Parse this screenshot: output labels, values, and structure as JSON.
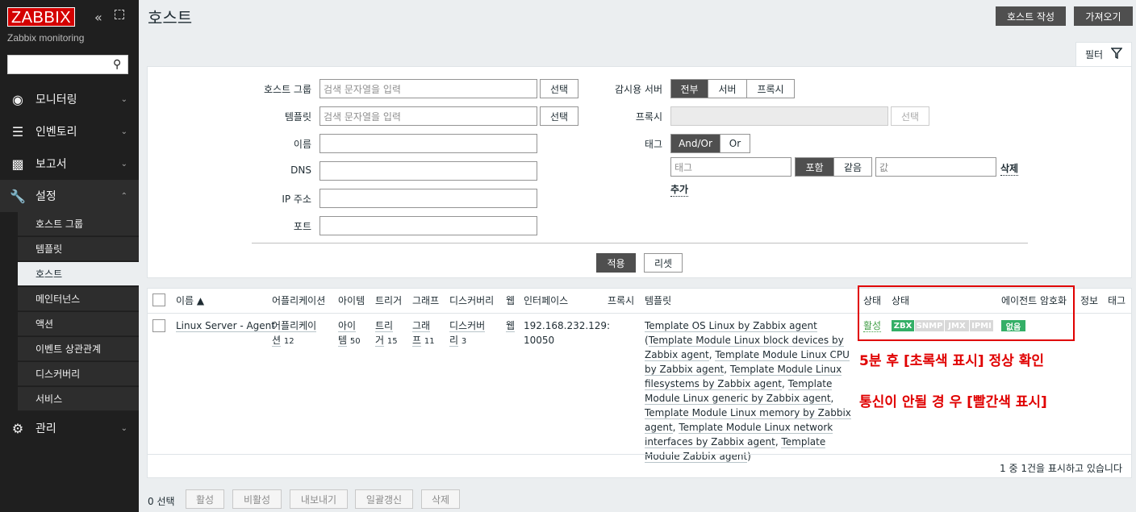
{
  "sidebar": {
    "logo": "ZABBIX",
    "collapse_icon": "«",
    "subtitle": "Zabbix monitoring",
    "search_placeholder": "",
    "menu": [
      {
        "label": "모니터링",
        "icon": "eye-icon"
      },
      {
        "label": "인벤토리",
        "icon": "list-icon"
      },
      {
        "label": "보고서",
        "icon": "bar-chart-icon"
      },
      {
        "label": "설정",
        "icon": "wrench-icon"
      },
      {
        "label": "관리",
        "icon": "gear-icon"
      }
    ],
    "config_submenu": [
      "호스트 그룹",
      "템플릿",
      "호스트",
      "메인터넌스",
      "액션",
      "이벤트 상관관계",
      "디스커버리",
      "서비스"
    ],
    "selected_submenu": "호스트"
  },
  "header": {
    "title": "호스트",
    "create_label": "호스트 작성",
    "import_label": "가져오기"
  },
  "filter": {
    "tab_label": "필터",
    "host_group_label": "호스트 그룹",
    "host_group_placeholder": "검색 문자열을 입력",
    "template_label": "템플릿",
    "template_placeholder": "검색 문자열을 입력",
    "name_label": "이름",
    "dns_label": "DNS",
    "ip_label": "IP 주소",
    "port_label": "포트",
    "select_label": "선택",
    "monitored_by_label": "감시용 서버",
    "monitored_by_options": [
      "전부",
      "서버",
      "프록시"
    ],
    "monitored_by_selected": "전부",
    "proxy_label": "프록시",
    "tags_label": "태그",
    "tag_logic_options": [
      "And/Or",
      "Or"
    ],
    "tag_logic_selected": "And/Or",
    "tag_placeholder": "태그",
    "tag_operator_options": [
      "포함",
      "같음"
    ],
    "tag_operator_selected": "포함",
    "value_placeholder": "값",
    "remove_label": "삭제",
    "add_label": "추가",
    "apply_label": "적용",
    "reset_label": "리셋"
  },
  "table": {
    "headers": [
      "이름 ▲",
      "어플리케이션",
      "아이템",
      "트리거",
      "그래프",
      "디스커버리",
      "웹",
      "인터페이스",
      "프록시",
      "템플릿",
      "상태",
      "상태",
      "에이전트 암호화",
      "정보",
      "태그"
    ],
    "rows": [
      {
        "name": "Linux Server - Agent",
        "applications_line1": "어플리케이",
        "applications_line2": "션",
        "applications_count": "12",
        "items_line1": "아이",
        "items_line2": "템",
        "items_count": "50",
        "triggers_line1": "트리",
        "triggers_line2": "거",
        "triggers_count": "15",
        "graphs_line1": "그래",
        "graphs_line2": "프",
        "graphs_count": "11",
        "discovery_line1": "디스커버",
        "discovery_line2": "리",
        "discovery_count": "3",
        "web": "웹",
        "interface_line1": "192.168.232.129:",
        "interface_line2": "10050",
        "templates": [
          "Template OS Linux by Zabbix agent",
          "Template Module Linux block devices by Zabbix agent",
          "Template Module Linux CPU by Zabbix agent",
          "Template Module Linux filesystems by Zabbix agent",
          "Template Module Linux generic by Zabbix agent",
          "Template Module Linux memory by Zabbix agent",
          "Template Module Linux network interfaces by Zabbix agent",
          "Template Module Zabbix agent"
        ],
        "status": "활성",
        "availability": [
          "ZBX",
          "SNMP",
          "JMX",
          "IPMI"
        ],
        "encryption": "없음"
      }
    ],
    "summary": "1 중 1건을 표시하고 있습니다"
  },
  "annotations": {
    "line1": "5분 후 [초록색 표시] 정상 확인",
    "line2": "통신이 안될 경 우 [빨간색 표시]"
  },
  "footer": {
    "selected_count": "0 선택",
    "actions": [
      "활성",
      "비활성",
      "내보내기",
      "일괄갱신",
      "삭제"
    ]
  },
  "colors": {
    "logo_red": "#d40000",
    "zbx_green": "#34af67",
    "status_green": "#429e47",
    "annotation_red": "#e00000"
  }
}
